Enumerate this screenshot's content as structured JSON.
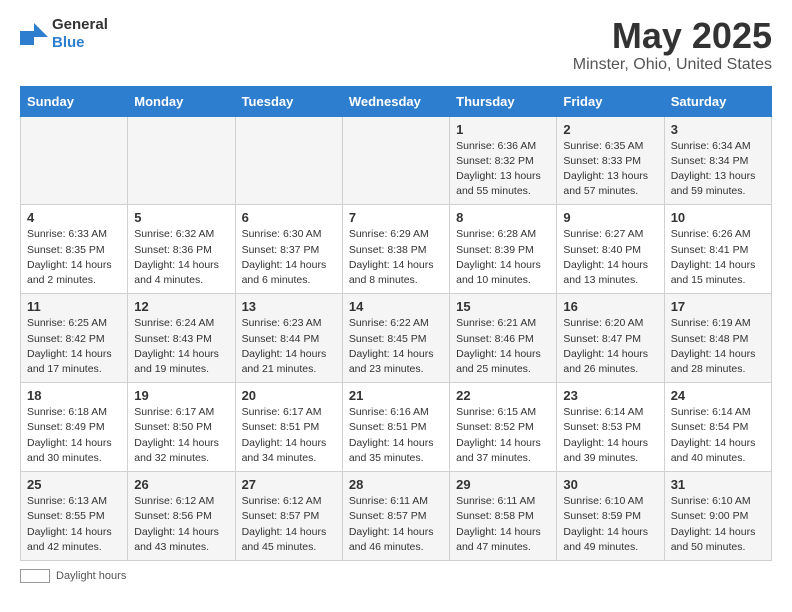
{
  "header": {
    "logo_general": "General",
    "logo_blue": "Blue",
    "title": "May 2025",
    "subtitle": "Minster, Ohio, United States"
  },
  "days_of_week": [
    "Sunday",
    "Monday",
    "Tuesday",
    "Wednesday",
    "Thursday",
    "Friday",
    "Saturday"
  ],
  "weeks": [
    [
      {
        "day": "",
        "info": ""
      },
      {
        "day": "",
        "info": ""
      },
      {
        "day": "",
        "info": ""
      },
      {
        "day": "",
        "info": ""
      },
      {
        "day": "1",
        "info": "Sunrise: 6:36 AM\nSunset: 8:32 PM\nDaylight: 13 hours and 55 minutes."
      },
      {
        "day": "2",
        "info": "Sunrise: 6:35 AM\nSunset: 8:33 PM\nDaylight: 13 hours and 57 minutes."
      },
      {
        "day": "3",
        "info": "Sunrise: 6:34 AM\nSunset: 8:34 PM\nDaylight: 13 hours and 59 minutes."
      }
    ],
    [
      {
        "day": "4",
        "info": "Sunrise: 6:33 AM\nSunset: 8:35 PM\nDaylight: 14 hours and 2 minutes."
      },
      {
        "day": "5",
        "info": "Sunrise: 6:32 AM\nSunset: 8:36 PM\nDaylight: 14 hours and 4 minutes."
      },
      {
        "day": "6",
        "info": "Sunrise: 6:30 AM\nSunset: 8:37 PM\nDaylight: 14 hours and 6 minutes."
      },
      {
        "day": "7",
        "info": "Sunrise: 6:29 AM\nSunset: 8:38 PM\nDaylight: 14 hours and 8 minutes."
      },
      {
        "day": "8",
        "info": "Sunrise: 6:28 AM\nSunset: 8:39 PM\nDaylight: 14 hours and 10 minutes."
      },
      {
        "day": "9",
        "info": "Sunrise: 6:27 AM\nSunset: 8:40 PM\nDaylight: 14 hours and 13 minutes."
      },
      {
        "day": "10",
        "info": "Sunrise: 6:26 AM\nSunset: 8:41 PM\nDaylight: 14 hours and 15 minutes."
      }
    ],
    [
      {
        "day": "11",
        "info": "Sunrise: 6:25 AM\nSunset: 8:42 PM\nDaylight: 14 hours and 17 minutes."
      },
      {
        "day": "12",
        "info": "Sunrise: 6:24 AM\nSunset: 8:43 PM\nDaylight: 14 hours and 19 minutes."
      },
      {
        "day": "13",
        "info": "Sunrise: 6:23 AM\nSunset: 8:44 PM\nDaylight: 14 hours and 21 minutes."
      },
      {
        "day": "14",
        "info": "Sunrise: 6:22 AM\nSunset: 8:45 PM\nDaylight: 14 hours and 23 minutes."
      },
      {
        "day": "15",
        "info": "Sunrise: 6:21 AM\nSunset: 8:46 PM\nDaylight: 14 hours and 25 minutes."
      },
      {
        "day": "16",
        "info": "Sunrise: 6:20 AM\nSunset: 8:47 PM\nDaylight: 14 hours and 26 minutes."
      },
      {
        "day": "17",
        "info": "Sunrise: 6:19 AM\nSunset: 8:48 PM\nDaylight: 14 hours and 28 minutes."
      }
    ],
    [
      {
        "day": "18",
        "info": "Sunrise: 6:18 AM\nSunset: 8:49 PM\nDaylight: 14 hours and 30 minutes."
      },
      {
        "day": "19",
        "info": "Sunrise: 6:17 AM\nSunset: 8:50 PM\nDaylight: 14 hours and 32 minutes."
      },
      {
        "day": "20",
        "info": "Sunrise: 6:17 AM\nSunset: 8:51 PM\nDaylight: 14 hours and 34 minutes."
      },
      {
        "day": "21",
        "info": "Sunrise: 6:16 AM\nSunset: 8:51 PM\nDaylight: 14 hours and 35 minutes."
      },
      {
        "day": "22",
        "info": "Sunrise: 6:15 AM\nSunset: 8:52 PM\nDaylight: 14 hours and 37 minutes."
      },
      {
        "day": "23",
        "info": "Sunrise: 6:14 AM\nSunset: 8:53 PM\nDaylight: 14 hours and 39 minutes."
      },
      {
        "day": "24",
        "info": "Sunrise: 6:14 AM\nSunset: 8:54 PM\nDaylight: 14 hours and 40 minutes."
      }
    ],
    [
      {
        "day": "25",
        "info": "Sunrise: 6:13 AM\nSunset: 8:55 PM\nDaylight: 14 hours and 42 minutes."
      },
      {
        "day": "26",
        "info": "Sunrise: 6:12 AM\nSunset: 8:56 PM\nDaylight: 14 hours and 43 minutes."
      },
      {
        "day": "27",
        "info": "Sunrise: 6:12 AM\nSunset: 8:57 PM\nDaylight: 14 hours and 45 minutes."
      },
      {
        "day": "28",
        "info": "Sunrise: 6:11 AM\nSunset: 8:57 PM\nDaylight: 14 hours and 46 minutes."
      },
      {
        "day": "29",
        "info": "Sunrise: 6:11 AM\nSunset: 8:58 PM\nDaylight: 14 hours and 47 minutes."
      },
      {
        "day": "30",
        "info": "Sunrise: 6:10 AM\nSunset: 8:59 PM\nDaylight: 14 hours and 49 minutes."
      },
      {
        "day": "31",
        "info": "Sunrise: 6:10 AM\nSunset: 9:00 PM\nDaylight: 14 hours and 50 minutes."
      }
    ]
  ],
  "footer": {
    "daylight_label": "Daylight hours"
  }
}
